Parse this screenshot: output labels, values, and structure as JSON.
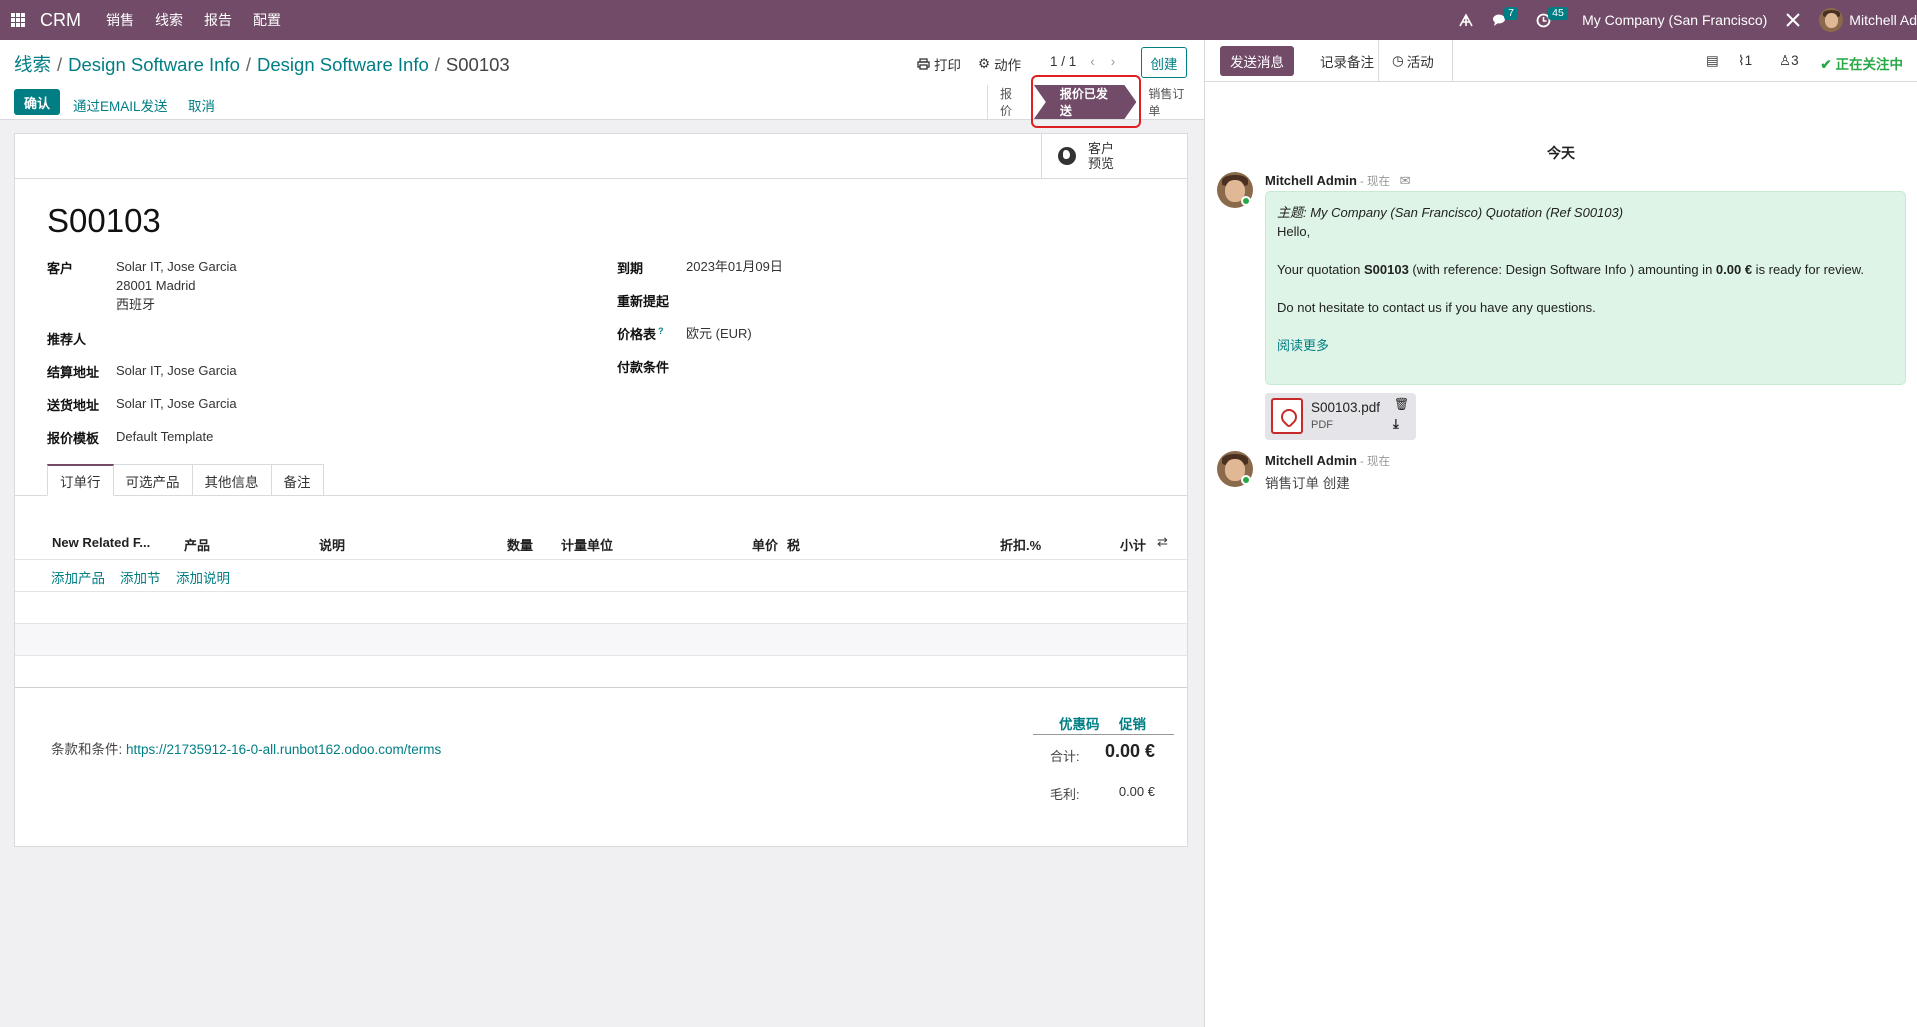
{
  "navbar": {
    "app": "CRM",
    "menus": [
      "销售",
      "线索",
      "报告",
      "配置"
    ],
    "messages_count": "7",
    "activities_count": "45",
    "company": "My Company (San Francisco)",
    "user": "Mitchell Ad"
  },
  "breadcrumb": {
    "items": [
      "线索",
      "Design Software Info",
      "Design Software Info"
    ],
    "current": "S00103"
  },
  "toolbar": {
    "print": "打印",
    "action": "动作",
    "pager": "1 / 1",
    "create": "创建"
  },
  "actions": {
    "confirm": "确认",
    "send_email": "通过EMAIL发送",
    "cancel": "取消"
  },
  "statusbar": {
    "items": [
      "报价",
      "报价已发送",
      "销售订单"
    ],
    "active": "报价已发送"
  },
  "sheet": {
    "preview_line1": "客户",
    "preview_line2": "预览",
    "name": "S00103",
    "left_fields": [
      {
        "label": "客户",
        "lines": [
          "Solar IT, Jose Garcia",
          "28001 Madrid",
          "西班牙"
        ]
      },
      {
        "label": "推荐人",
        "value": ""
      },
      {
        "label": "结算地址",
        "value": "Solar IT, Jose Garcia"
      },
      {
        "label": "送货地址",
        "value": "Solar IT, Jose Garcia"
      },
      {
        "label": "报价模板",
        "value": "Default Template"
      }
    ],
    "right_fields": [
      {
        "label": "到期",
        "value": "2023年01月09日"
      },
      {
        "label": "重新提起",
        "value": ""
      },
      {
        "label": "价格表",
        "help": "?",
        "value": "欧元 (EUR)"
      },
      {
        "label": "付款条件",
        "value": ""
      }
    ],
    "tabs": [
      "订单行",
      "可选产品",
      "其他信息",
      "备注"
    ],
    "columns": [
      "New Related F...",
      "产品",
      "说明",
      "数量",
      "计量单位",
      "单价",
      "税",
      "折扣.%",
      "小计"
    ],
    "add_links": [
      "添加产品",
      "添加节",
      "添加说明"
    ],
    "terms_label": "条款和条件:",
    "terms_url": "https://21735912-16-0-all.runbot162.odoo.com/terms",
    "coupon": "优惠码",
    "promotion": "促销",
    "total_label": "合计:",
    "total_value": "0.00 €",
    "margin_label": "毛利:",
    "margin_value": "0.00 €"
  },
  "chatter": {
    "send_message": "发送消息",
    "log_note": "记录备注",
    "activity": "活动",
    "attachments_count": "1",
    "followers_count": "3",
    "following": "正在关注中",
    "today": "今天",
    "messages": [
      {
        "author": "Mitchell Admin",
        "ago": "- 现在",
        "subject": "主题: My Company (San Francisco) Quotation (Ref S00103)",
        "greeting": "Hello,",
        "body_pre": "Your quotation ",
        "body_ref": "S00103",
        "body_mid": " (with reference: Design Software Info ) amounting in ",
        "body_amount": "0.00 €",
        "body_post": " is ready for review.",
        "contact": "Do not hesitate to contact us if you have any questions.",
        "read_more": "阅读更多",
        "attachment_name": "S00103.pdf",
        "attachment_type": "PDF"
      },
      {
        "author": "Mitchell Admin",
        "ago": "- 现在",
        "body": "销售订单 创建"
      }
    ]
  }
}
